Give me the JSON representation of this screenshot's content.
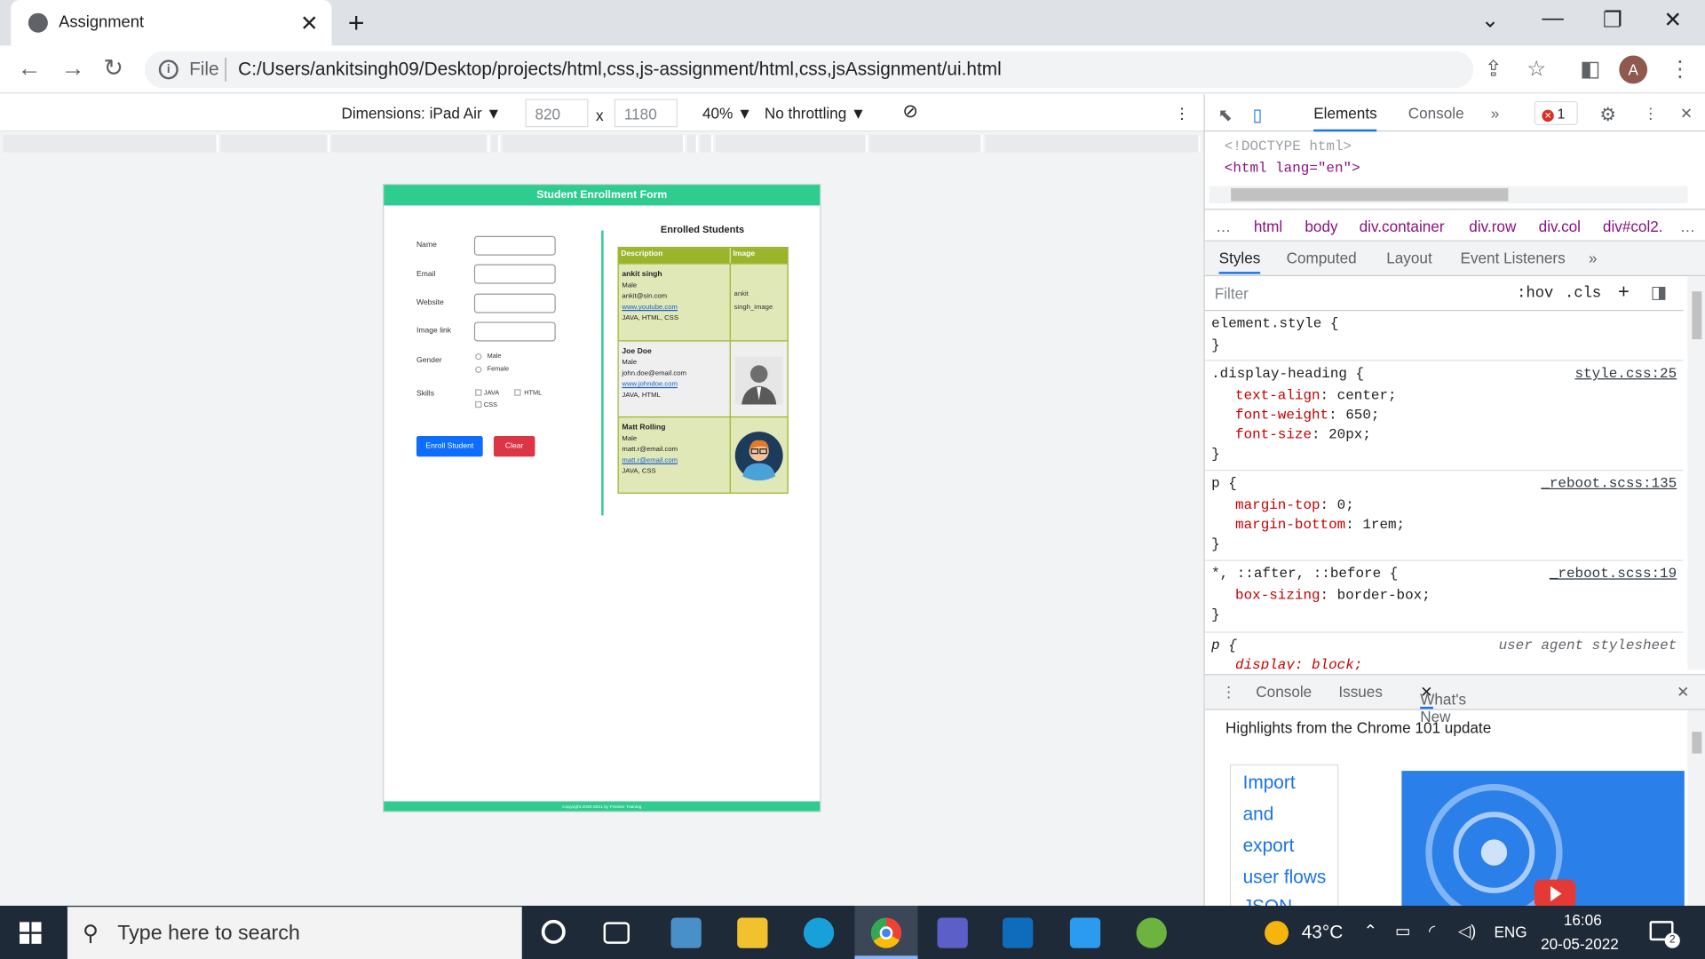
{
  "browser": {
    "tab_title": "Assignment",
    "url_scheme": "File",
    "url": "C:/Users/ankitsingh09/Desktop/projects/html,css,js-assignment/html,css,jsAssignment/ui.html",
    "avatar_letter": "A"
  },
  "device_toolbar": {
    "dimensions_label": "Dimensions: iPad Air",
    "width": "820",
    "times": "x",
    "height": "1180",
    "zoom": "40%",
    "throttling": "No throttling"
  },
  "page": {
    "title": "Student Enrollment Form",
    "footer": "Copyright 2020-2021 by Fresher Training",
    "form": {
      "name_label": "Name",
      "email_label": "Email",
      "website_label": "Website",
      "image_label": "Image link",
      "gender_label": "Gender",
      "gender_options": [
        "Male",
        "Female"
      ],
      "skills_label": "Skills",
      "skill_options": [
        "JAVA",
        "HTML",
        "CSS"
      ],
      "enroll_button": "Enroll Student",
      "clear_button": "Clear"
    },
    "enrolled": {
      "heading": "Enrolled Students",
      "col_description": "Description",
      "col_image": "Image",
      "students": [
        {
          "name": "ankit singh",
          "gender": "Male",
          "email": "ankit@sin.com",
          "website": "www.youtube.com",
          "skills": "JAVA, HTML, CSS",
          "image_alt": "ankit singh_image"
        },
        {
          "name": "Joe Doe",
          "gender": "Male",
          "email": "john.doe@email.com",
          "website": "www.johndoe.com",
          "skills": "JAVA, HTML"
        },
        {
          "name": "Matt Rolling",
          "gender": "Male",
          "email": "matt.r@email.com",
          "website": "matt.r@email.com",
          "skills": "JAVA, CSS"
        }
      ]
    }
  },
  "devtools": {
    "tabs": [
      "Elements",
      "Console"
    ],
    "error_count": "1",
    "dom_lines": [
      "<!DOCTYPE html>",
      "<html lang=\"en\">"
    ],
    "breadcrumbs": [
      "html",
      "body",
      "div.container",
      "div.row",
      "div.col",
      "div#col2."
    ],
    "subtabs": [
      "Styles",
      "Computed",
      "Layout",
      "Event Listeners"
    ],
    "filter_placeholder": "Filter",
    "hov": ":hov",
    "cls": ".cls",
    "rules": {
      "element_style": "element.style {",
      "close": "}",
      "r1_selector": ".display-heading {",
      "r1_source": "style.css:25",
      "r1_p1_name": "text-align",
      "r1_p1_value": "center;",
      "r1_p2_name": "font-weight",
      "r1_p2_value": "650;",
      "r1_p3_name": "font-size",
      "r1_p3_value": "20px;",
      "r2_selector": "p {",
      "r2_source": "_reboot.scss:135",
      "r2_p1_name": "margin-top",
      "r2_p1_value": "0;",
      "r2_p2_name": "margin-bottom",
      "r2_p2_value": "1rem;",
      "r3_selector": "*, ::after, ::before {",
      "r3_source": "_reboot.scss:19",
      "r3_p1_name": "box-sizing",
      "r3_p1_value": "border-box;",
      "r4_selector": "p {",
      "r4_source": "user agent stylesheet",
      "r4_p1": "display: block;"
    },
    "drawer": {
      "tabs": [
        "Console",
        "Issues",
        "What's New"
      ],
      "highlight": "Highlights from the Chrome 101 update",
      "link_lines": [
        "Import",
        "and",
        "export",
        "user flows",
        "JSON"
      ]
    }
  },
  "taskbar": {
    "search_placeholder": "Type here to search",
    "temperature": "43°C",
    "language": "ENG",
    "time": "16:06",
    "date": "20-05-2022",
    "notifications": "2"
  }
}
